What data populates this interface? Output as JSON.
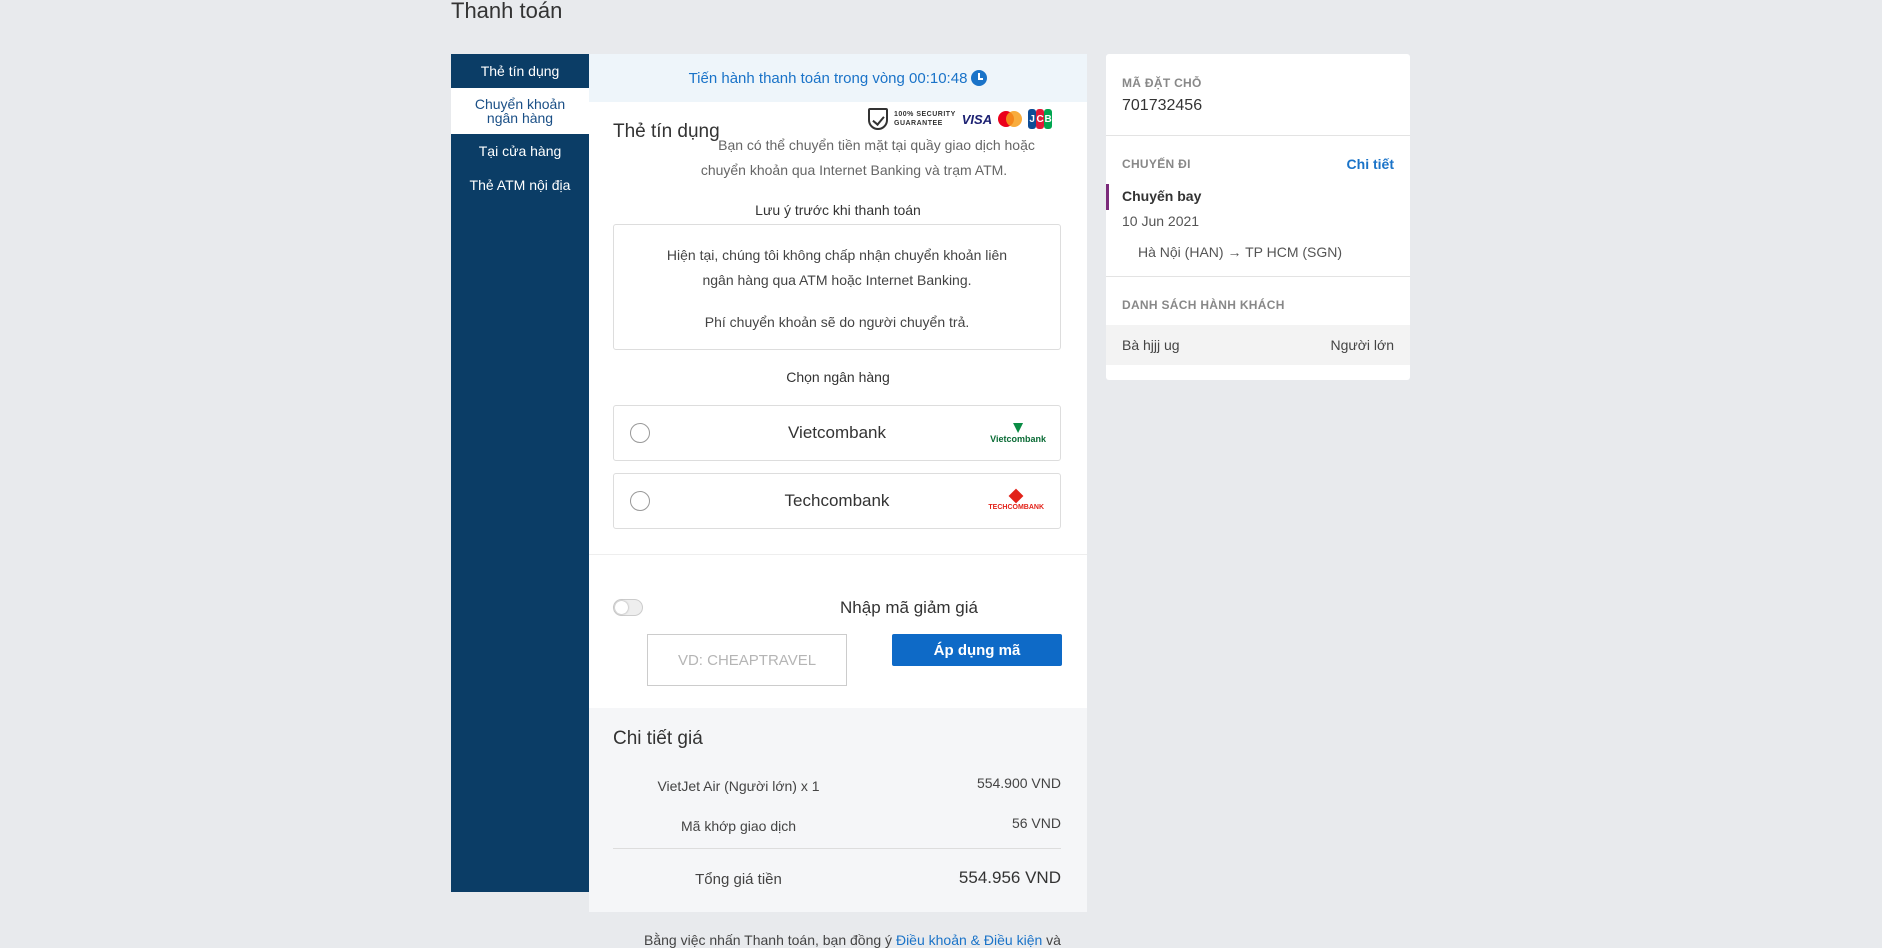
{
  "page": {
    "title": "Thanh toán"
  },
  "sidebar": {
    "items": [
      {
        "label": "Thẻ tín dụng"
      },
      {
        "label": "Chuyển khoản ngân hàng"
      },
      {
        "label": "Tại cửa hàng"
      },
      {
        "label": "Thẻ ATM nội địa"
      }
    ]
  },
  "timer": {
    "text": "Tiến hành thanh toán trong vòng 00:10:48"
  },
  "card": {
    "title": "Thẻ tín dụng",
    "guarantee_line1": "100% SECURITY",
    "guarantee_line2": "GUARANTEE",
    "visa": "VISA",
    "jcb": [
      "J",
      "C",
      "B"
    ],
    "intro": "Bạn có thể chuyển tiền mặt tại quầy giao dịch hoặc chuyển khoản qua Internet Banking và trạm ATM."
  },
  "notice": {
    "heading": "Lưu ý trước khi thanh toán",
    "line1": "Hiện tại, chúng tôi không chấp nhận chuyển khoản liên ngân hàng qua ATM hoặc Internet Banking.",
    "line2": "Phí chuyển khoản sẽ do người chuyển trả."
  },
  "banks": {
    "heading": "Chọn ngân hàng",
    "options": [
      {
        "name": "Vietcombank",
        "logo_text": "Vietcombank"
      },
      {
        "name": "Techcombank",
        "logo_text": "TECHCOMBANK"
      }
    ]
  },
  "discount": {
    "label": "Nhập mã giảm giá",
    "placeholder": "VD: CHEAPTRAVEL",
    "apply_label": "Áp dụng mã",
    "enabled": false
  },
  "price": {
    "title": "Chi tiết giá",
    "rows": [
      {
        "label": "VietJet Air (Người lớn) x 1",
        "value": "554.900 VND"
      },
      {
        "label": "Mã khớp giao dịch",
        "value": "56 VND"
      }
    ],
    "total_label": "Tổng giá tiền",
    "total_value": "554.956 VND"
  },
  "terms": {
    "prefix": "Bằng việc nhấn Thanh toán, bạn đồng ý",
    "link": "Điều khoản & Điều kiện",
    "suffix": "và"
  },
  "summary": {
    "booking_label": "MÃ ĐẶT CHỖ",
    "booking_code": "701732456",
    "trip_label": "CHUYẾN ĐI",
    "detail_link": "Chi tiết",
    "flight_type": "Chuyến bay",
    "flight_date": "10 Jun 2021",
    "route": "Hà Nội (HAN) → TP HCM (SGN)",
    "passengers_label": "DANH SÁCH HÀNH KHÁCH",
    "passenger_name": "Bà hjjj ug",
    "passenger_type": "Người lớn"
  },
  "colors": {
    "nav_bg": "#0b3d66",
    "accent": "#1a73c8",
    "button": "#0e6ac7",
    "page_bg": "#e8eaed"
  }
}
